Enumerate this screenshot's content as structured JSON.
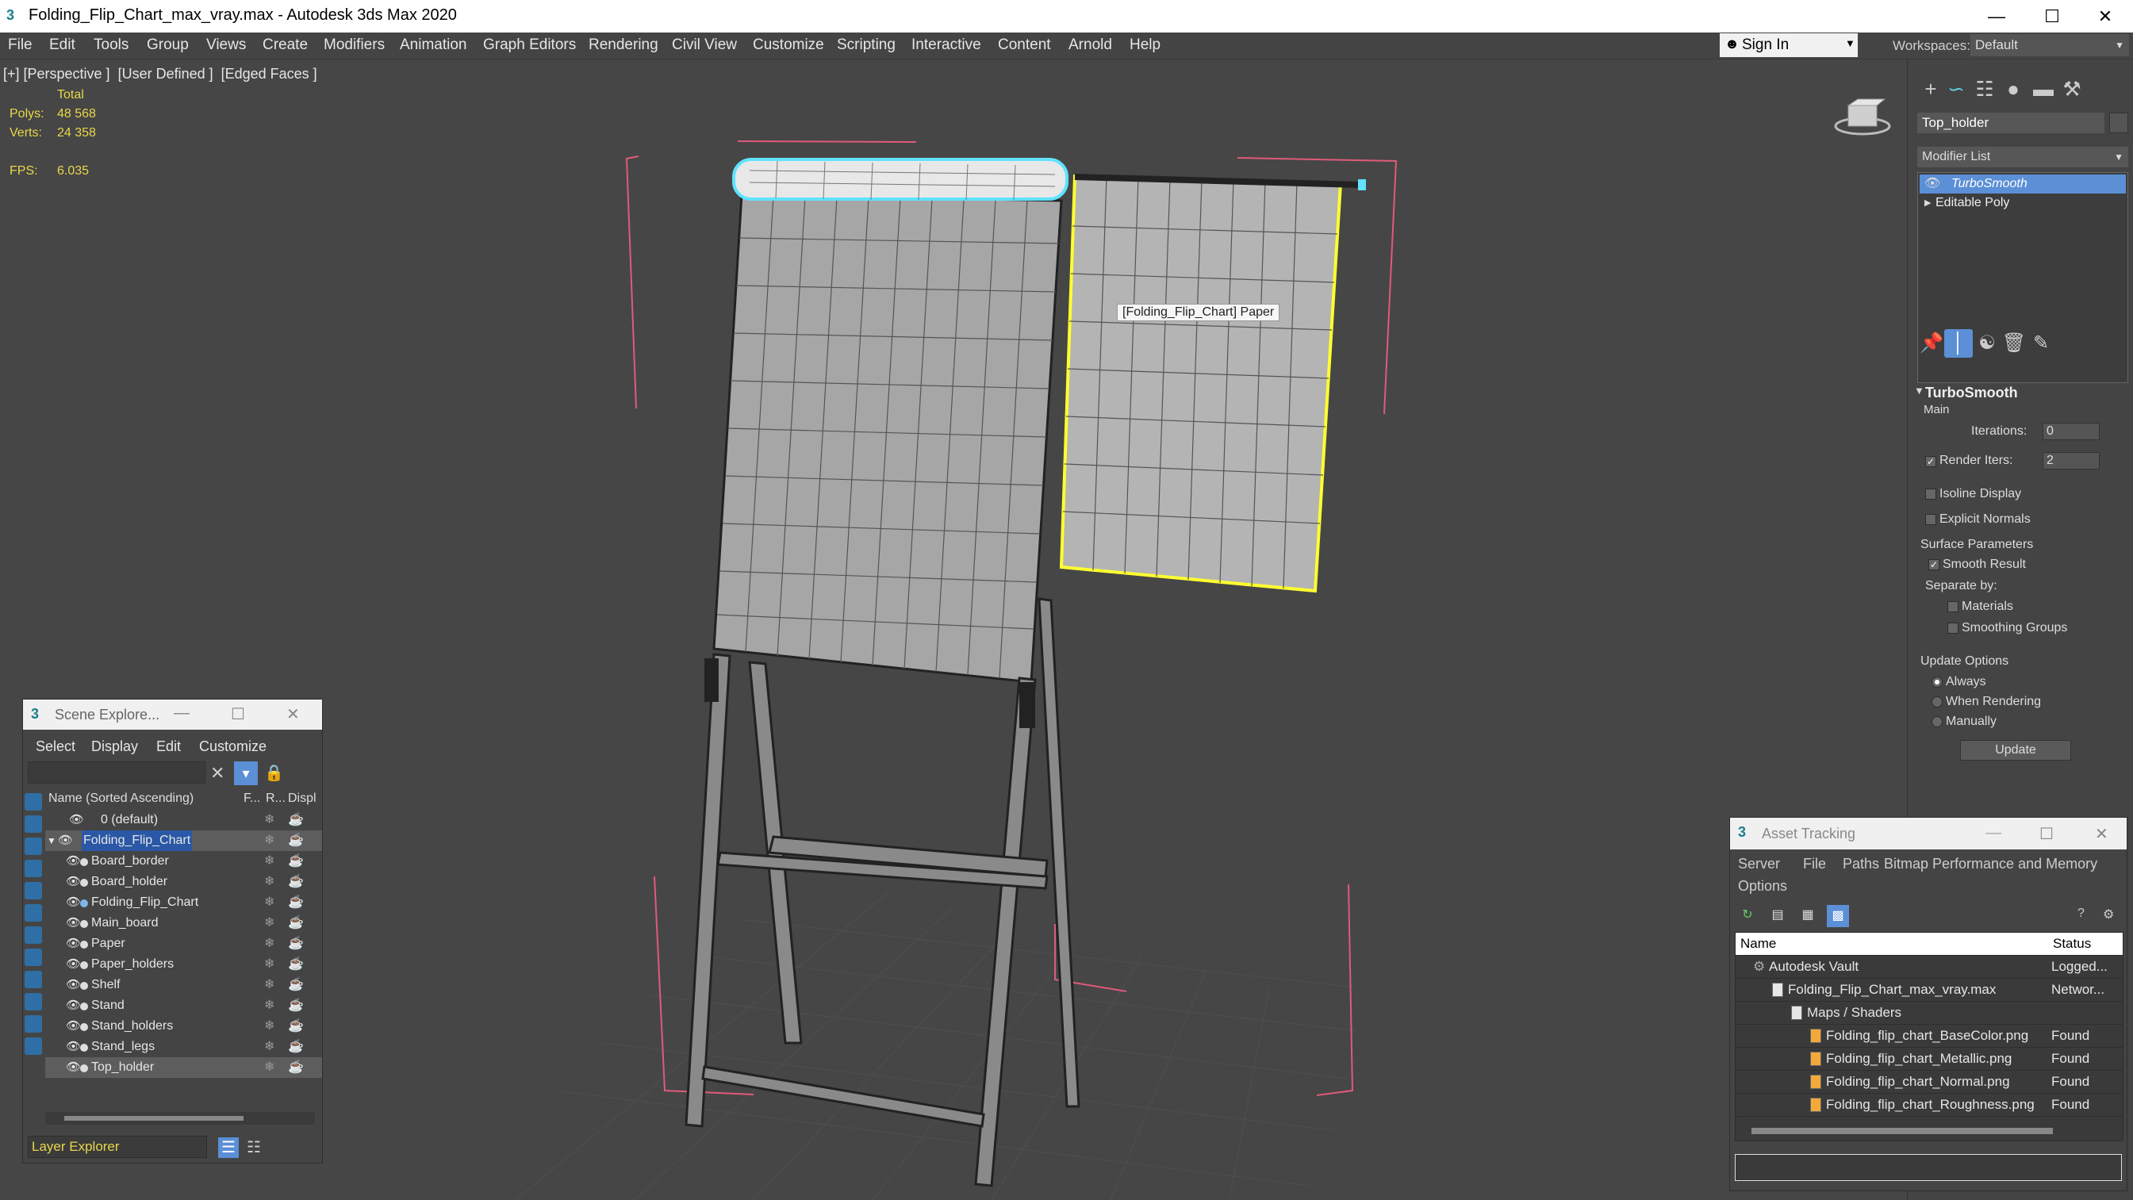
{
  "window": {
    "title": "Folding_Flip_Chart_max_vray.max - Autodesk 3ds Max 2020",
    "minimize": "—",
    "maximize": "☐",
    "close": "✕"
  },
  "menu": {
    "items": [
      "File",
      "Edit",
      "Tools",
      "Group",
      "Views",
      "Create",
      "Modifiers",
      "Animation",
      "Graph Editors",
      "Rendering",
      "Civil View",
      "Customize",
      "Scripting",
      "Interactive",
      "Content",
      "Arnold",
      "Help"
    ],
    "sign_in": "Sign In",
    "workspaces_label": "Workspaces:",
    "workspace_value": "Default"
  },
  "viewport": {
    "label": "[+] [Perspective ]  [User Defined ]  [Edged Faces ]",
    "stats": {
      "total_label": "Total",
      "polys_label": "Polys:",
      "polys_value": "48 568",
      "verts_label": "Verts:",
      "verts_value": "24 358",
      "fps_label": "FPS:",
      "fps_value": "6.035"
    },
    "tooltip": "[Folding_Flip_Chart] Paper",
    "colors": {
      "selection_cyan": "#5fe3ff",
      "selection_yellow": "#ffff30",
      "bbox_pink": "#e05a7a"
    }
  },
  "command_panel": {
    "object_name": "Top_holder",
    "modifier_list": "Modifier List",
    "stack": [
      {
        "label": "TurboSmooth",
        "selected": true
      },
      {
        "label": "Editable Poly",
        "selected": false
      }
    ],
    "rollout": {
      "title": "TurboSmooth",
      "main_label": "Main",
      "iterations_label": "Iterations:",
      "iterations_value": "0",
      "render_iters_label": "Render Iters:",
      "render_iters_value": "2",
      "isoline_display": "Isoline Display",
      "explicit_normals": "Explicit Normals",
      "surface_parameters": "Surface Parameters",
      "smooth_result": "Smooth Result",
      "separate_by": "Separate by:",
      "materials": "Materials",
      "smoothing_groups": "Smoothing Groups",
      "update_options": "Update Options",
      "always": "Always",
      "when_rendering": "When Rendering",
      "manually": "Manually",
      "update_button": "Update"
    }
  },
  "scene_explorer": {
    "title": "Scene Explore...",
    "menu": [
      "Select",
      "Display",
      "Edit",
      "Customize"
    ],
    "columns": {
      "name": "Name (Sorted Ascending)",
      "freeze": "F...",
      "render": "R...",
      "display": "Displ"
    },
    "rows": [
      {
        "name": "0 (default)",
        "level": 0,
        "type": "layer",
        "selected": false
      },
      {
        "name": "Folding_Flip_Chart",
        "level": 0,
        "type": "layer",
        "selected": true
      },
      {
        "name": "Board_border",
        "level": 1,
        "type": "object",
        "selected": false
      },
      {
        "name": "Board_holder",
        "level": 1,
        "type": "object",
        "selected": false
      },
      {
        "name": "Folding_Flip_Chart",
        "level": 1,
        "type": "group",
        "selected": false
      },
      {
        "name": "Main_board",
        "level": 1,
        "type": "object",
        "selected": false
      },
      {
        "name": "Paper",
        "level": 1,
        "type": "object",
        "selected": false
      },
      {
        "name": "Paper_holders",
        "level": 1,
        "type": "object",
        "selected": false
      },
      {
        "name": "Shelf",
        "level": 1,
        "type": "object",
        "selected": false
      },
      {
        "name": "Stand",
        "level": 1,
        "type": "object",
        "selected": false
      },
      {
        "name": "Stand_holders",
        "level": 1,
        "type": "object",
        "selected": false
      },
      {
        "name": "Stand_legs",
        "level": 1,
        "type": "object",
        "selected": false
      },
      {
        "name": "Top_holder",
        "level": 1,
        "type": "object",
        "selected": true
      }
    ],
    "layer_explorer": "Layer Explorer"
  },
  "asset_tracking": {
    "title": "Asset Tracking",
    "menu": [
      "Server",
      "File",
      "Paths",
      "Bitmap Performance and Memory",
      "Options"
    ],
    "columns": {
      "name": "Name",
      "status": "Status"
    },
    "rows": [
      {
        "name": "Autodesk Vault",
        "status": "Logged...",
        "level": 0,
        "icon": "vault"
      },
      {
        "name": "Folding_Flip_Chart_max_vray.max",
        "status": "Networ...",
        "level": 1,
        "icon": "max"
      },
      {
        "name": "Maps / Shaders",
        "status": "",
        "level": 2,
        "icon": "folder"
      },
      {
        "name": "Folding_flip_chart_BaseColor.png",
        "status": "Found",
        "level": 3,
        "icon": "png"
      },
      {
        "name": "Folding_flip_chart_Metallic.png",
        "status": "Found",
        "level": 3,
        "icon": "png"
      },
      {
        "name": "Folding_flip_chart_Normal.png",
        "status": "Found",
        "level": 3,
        "icon": "png"
      },
      {
        "name": "Folding_flip_chart_Roughness.png",
        "status": "Found",
        "level": 3,
        "icon": "png"
      }
    ]
  }
}
